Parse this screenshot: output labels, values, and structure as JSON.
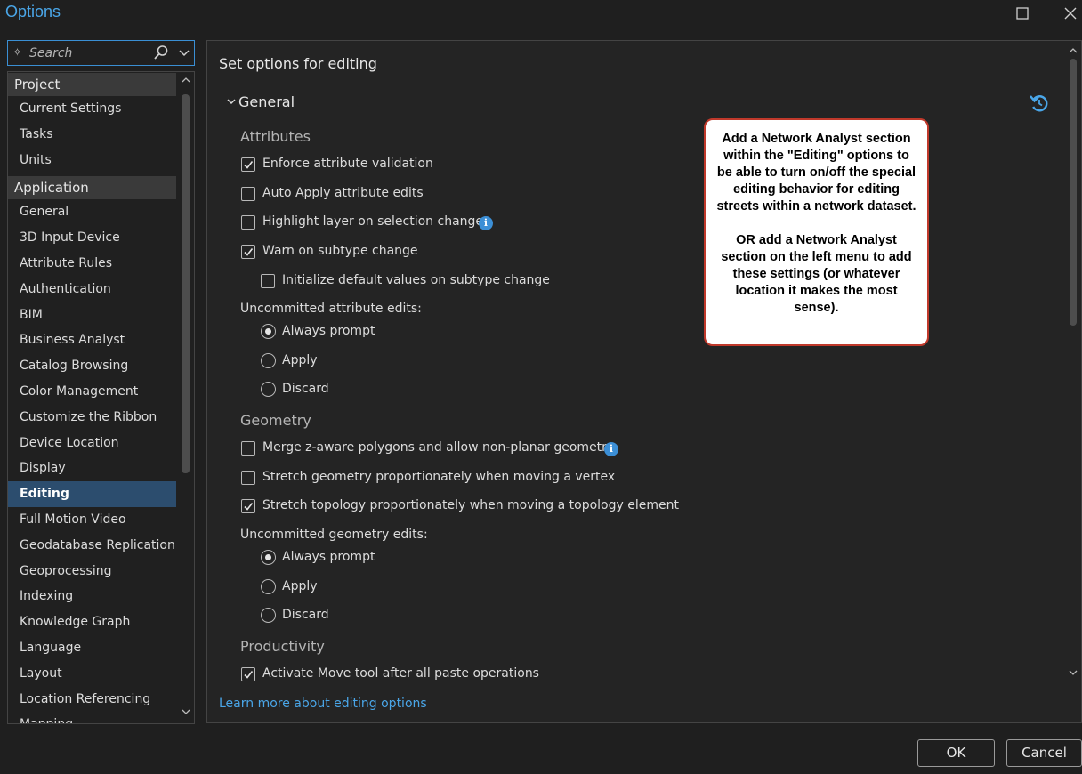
{
  "window": {
    "title": "Options"
  },
  "search": {
    "placeholder": "Search"
  },
  "nav": {
    "project_header": "Project",
    "project_items": [
      "Current Settings",
      "Tasks",
      "Units"
    ],
    "application_header": "Application",
    "application_items": [
      "General",
      "3D Input Device",
      "Attribute Rules",
      "Authentication",
      "BIM",
      "Business Analyst",
      "Catalog Browsing",
      "Color Management",
      "Customize the Ribbon",
      "Device Location",
      "Display",
      "Editing",
      "Full Motion Video",
      "Geodatabase Replication",
      "Geoprocessing",
      "Indexing",
      "Knowledge Graph",
      "Language",
      "Layout",
      "Location Referencing",
      "Mapping"
    ],
    "selected": "Editing"
  },
  "main": {
    "title": "Set options for editing",
    "section": "General",
    "attributes": {
      "heading": "Attributes",
      "enforce_validation": "Enforce attribute validation",
      "auto_apply": "Auto Apply attribute edits",
      "highlight_layer": "Highlight layer on selection change",
      "warn_subtype": "Warn on subtype change",
      "init_defaults": "Initialize default values on subtype change",
      "uncommitted_label": "Uncommitted attribute edits:",
      "always_prompt": "Always prompt",
      "apply": "Apply",
      "discard": "Discard"
    },
    "geometry": {
      "heading": "Geometry",
      "merge_z": "Merge z-aware polygons and allow non-planar geometry",
      "stretch_geometry": "Stretch geometry proportionately when moving a vertex",
      "stretch_topology": "Stretch topology proportionately when moving a topology element",
      "uncommitted_label": "Uncommitted geometry edits:",
      "always_prompt": "Always prompt",
      "apply": "Apply",
      "discard": "Discard"
    },
    "productivity": {
      "heading": "Productivity",
      "activate_move": "Activate Move tool after all paste operations"
    },
    "learn_more": "Learn more about editing options"
  },
  "callout": {
    "paragraph1": "Add a Network Analyst section within the \"Editing\" options to be able to turn on/off the special editing behavior for editing streets within a network dataset.",
    "paragraph2": "OR add a Network Analyst section on the left menu to add these settings (or whatever location it makes the most sense)."
  },
  "footer": {
    "ok": "OK",
    "cancel": "Cancel"
  },
  "colors": {
    "accent": "#4aa6e8",
    "selected_nav": "#2c4d6e",
    "callout_border": "#c0392b"
  }
}
